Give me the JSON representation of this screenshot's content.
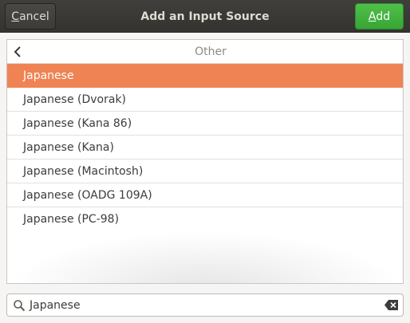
{
  "header": {
    "cancel_prefix": "C",
    "cancel_rest": "ancel",
    "title": "Add an Input Source",
    "add_prefix": "A",
    "add_rest": "dd"
  },
  "list": {
    "back_label": "Other",
    "items": [
      "Japanese",
      "Japanese (Dvorak)",
      "Japanese (Kana 86)",
      "Japanese (Kana)",
      "Japanese (Macintosh)",
      "Japanese (OADG 109A)",
      "Japanese (PC-98)"
    ],
    "selected_index": 0
  },
  "search": {
    "value": "Japanese"
  },
  "colors": {
    "header_bg": "#3c3b37",
    "accent_selection": "#ef8354",
    "add_button": "#3fb13a"
  },
  "icons": {
    "back": "chevron-left-icon",
    "search": "magnifier-icon",
    "clear": "backspace-clear-icon"
  }
}
